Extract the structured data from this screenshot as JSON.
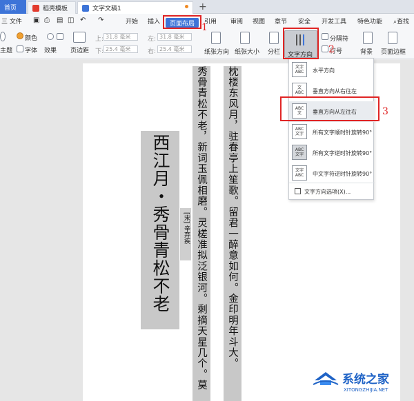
{
  "tabs": [
    {
      "label": "首页"
    },
    {
      "label": "稻壳模板"
    },
    {
      "label": "文字文稿1"
    }
  ],
  "menu": {
    "file": "三 文件",
    "items": [
      "开始",
      "插入",
      "页面布局",
      "引用",
      "审阅",
      "视图",
      "章节",
      "安全",
      "开发工具",
      "特色功能"
    ],
    "search": "查找"
  },
  "toolbar": {
    "color": "颜色",
    "theme": "主题",
    "font": "字体",
    "effect": "效果",
    "page_margin": "页边距",
    "top_label": "上:",
    "top_value": "31.8 毫米",
    "bottom_label": "下:",
    "bottom_value": "25.4 毫米",
    "left_label": "左:",
    "left_value": "31.8 毫米",
    "right_label": "右:",
    "right_value": "25.4 毫米",
    "orientation": "纸张方向",
    "size": "纸张大小",
    "columns": "分栏",
    "text_direction": "文字方向",
    "separator": "分隔符",
    "line_number": "行号",
    "background": "背景",
    "page_border": "页面边框"
  },
  "document": {
    "title": "西江月・秀骨青松不老",
    "author": "[宋] 辛弃疾",
    "col1": "秀骨青松不老，新词玉佩相磨。灵槎准拟泛银河。剩摘天星几个。莫",
    "col3": "枕楼东风月，驻春亭上笙歌。留君一醉意如何。金印明年斗大。"
  },
  "dropdown": {
    "items": [
      {
        "label": "水平方向",
        "icon": [
          "文字",
          "ABC"
        ]
      },
      {
        "label": "垂直方向从右往左",
        "icon": [
          "文",
          "ABC"
        ]
      },
      {
        "label": "垂直方向从左往右",
        "icon": [
          "ABC",
          "文"
        ]
      },
      {
        "label": "所有文字顺时针旋转90°",
        "icon": [
          "ABC",
          "文字"
        ]
      },
      {
        "label": "所有文字逆时针旋转90°",
        "icon": [
          "ABC",
          "文字"
        ]
      },
      {
        "label": "中文字符逆时针旋转90°",
        "icon": [
          "文字",
          "ABC"
        ]
      }
    ],
    "options": "文字方向选项(X)..."
  },
  "annotations": [
    "1",
    "2",
    "3"
  ],
  "watermark": {
    "text": "系统之家",
    "url": "XITONGZHIJIA.NET"
  },
  "colors": {
    "accent": "#3d74d8",
    "annotation": "#e02424",
    "selection_gray": "#c8c8c8"
  }
}
